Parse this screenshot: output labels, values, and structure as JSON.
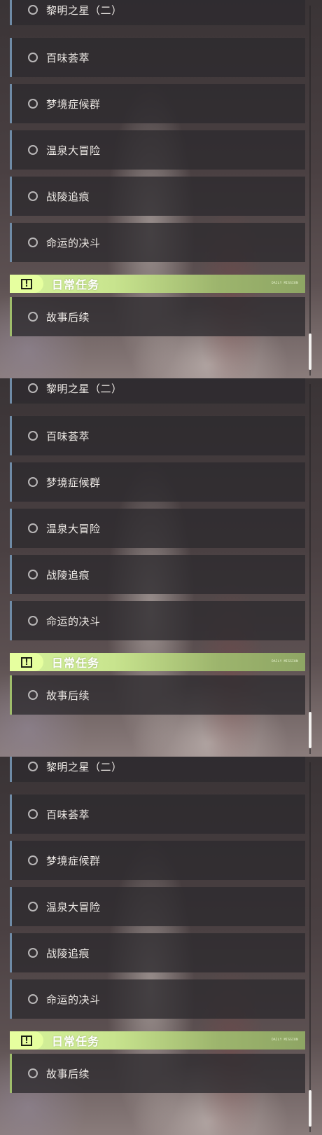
{
  "quests": [
    {
      "label": "黎明之星（二）"
    },
    {
      "label": "百味荟萃"
    },
    {
      "label": "梦境症候群"
    },
    {
      "label": "温泉大冒险"
    },
    {
      "label": "战陵追痕"
    },
    {
      "label": "命运的决斗"
    }
  ],
  "daily_section": {
    "title": "日常任务",
    "badge_glyph": "!",
    "tag": "DAILY MISSION",
    "quests": [
      {
        "label": "故事后续"
      }
    ]
  },
  "colors": {
    "main_stripe": "#6f8ba6",
    "daily_stripe": "#9fbd6b",
    "section_accent": "#d5f29b"
  },
  "icons": {
    "radio": "radio-unchecked-icon",
    "section_badge": "exclamation-box-icon"
  }
}
